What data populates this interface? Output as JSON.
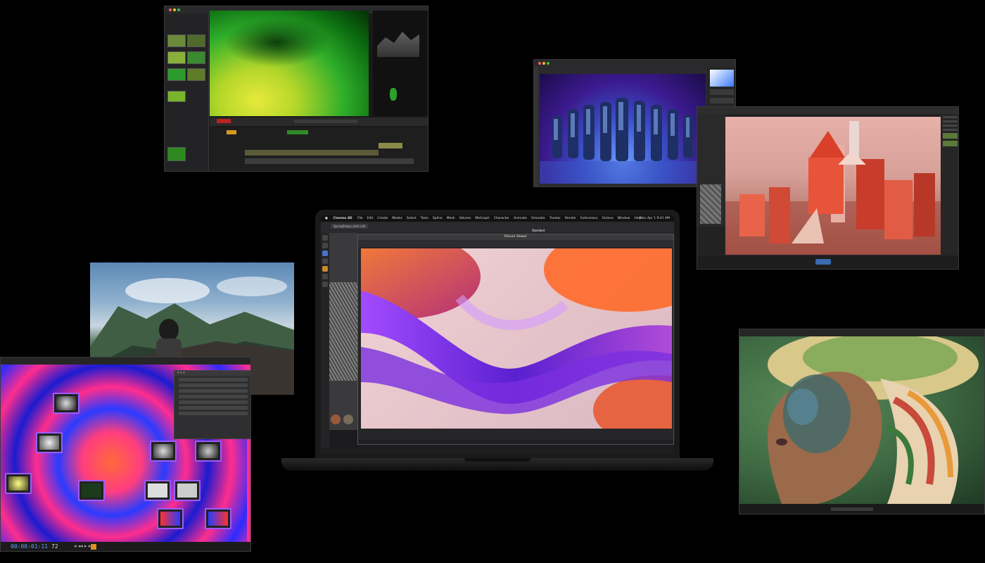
{
  "laptop": {
    "menubar": {
      "app_name": "Cinema 4D",
      "items": [
        "File",
        "Edit",
        "Create",
        "Modes",
        "Select",
        "Tools",
        "Spline",
        "Mesh",
        "Volume",
        "MoGraph",
        "Character",
        "Animate",
        "Simulate",
        "Tracker",
        "Render",
        "Extensions",
        "Octane",
        "Window",
        "Help"
      ],
      "clock": "Mon Apr 1  9:41 AM"
    },
    "picture_viewer_title": "Picture Viewer",
    "tab_label": "SpringShape_start.c4d",
    "layout_label": "Standard"
  },
  "fusion_window": {
    "timecode": "00:00:01:11",
    "frame": "72"
  },
  "colors": {
    "accent_purple": "#9a5cff",
    "fusion_bg": "#ff2d8d",
    "laptop_body": "#1a1a1a"
  }
}
